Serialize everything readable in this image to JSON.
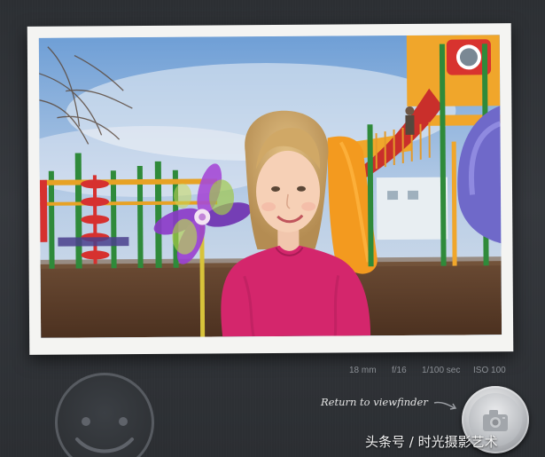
{
  "viewer": {
    "photo": {
      "alt": "Photo of a smiling girl in a pink shirt holding a pinwheel in front of a playground"
    },
    "exif": {
      "focal_length": "18 mm",
      "aperture": "f/16",
      "shutter_speed": "1/100 sec",
      "iso": "ISO 100"
    },
    "return_label": "Return to viewfinder",
    "icons": {
      "face": "smiley-face-icon",
      "arrow": "curved-arrow-icon",
      "camera": "camera-icon"
    }
  },
  "watermark": "头条号 / 时光摄影艺术",
  "colors": {
    "background": "#2f3236",
    "frame": "#f4f4f2",
    "exif_text": "#8b8f95",
    "label_text": "#e4e4e4",
    "shirt": "#d4266c"
  }
}
